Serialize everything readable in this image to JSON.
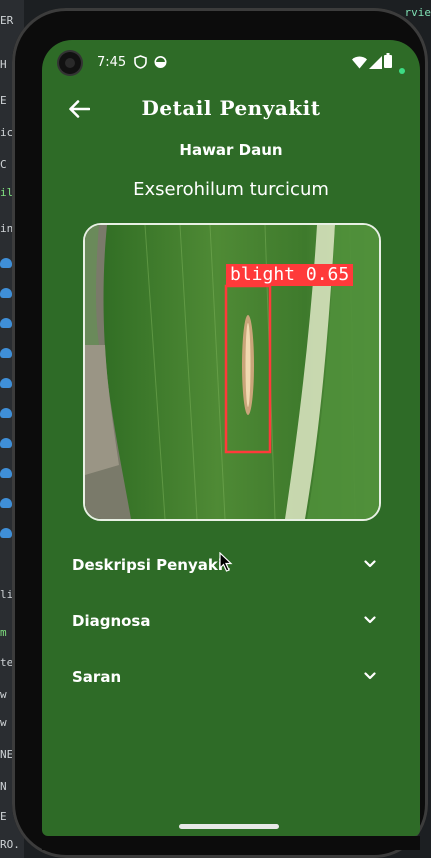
{
  "background_editor": {
    "right_text": "rvie",
    "left_fragments": [
      {
        "text": "ER",
        "color": "#cfd3d6"
      },
      {
        "text": "H",
        "color": "#cfd3d6"
      },
      {
        "text": "E",
        "color": "#cfd3d6"
      },
      {
        "text": "ic",
        "color": "#cfd3d6"
      },
      {
        "text": "C",
        "color": "#cfd3d6"
      },
      {
        "text": "ili",
        "color": "#7fe07f"
      },
      {
        "text": "in",
        "color": "#cfd3d6"
      },
      {
        "text": "lir",
        "color": "#cfd3d6"
      },
      {
        "text": "m",
        "color": "#7fe07f"
      },
      {
        "text": "te",
        "color": "#cfd3d6"
      },
      {
        "text": "w",
        "color": "#cfd3d6"
      },
      {
        "text": "w",
        "color": "#cfd3d6"
      },
      {
        "text": "NE",
        "color": "#cfd3d6"
      },
      {
        "text": "N",
        "color": "#cfd3d6"
      },
      {
        "text": "E",
        "color": "#cfd3d6"
      },
      {
        "text": "RO.",
        "color": "#cfd3d6"
      }
    ]
  },
  "status_bar": {
    "time": "7:45",
    "left_icons": [
      "shield-icon",
      "circle-half-icon"
    ],
    "right_icons": [
      "wifi-icon",
      "signal-icon",
      "battery-icon"
    ],
    "indicator_color": "#3ddc84"
  },
  "app_bar": {
    "title": "Detail Penyakit",
    "back_icon": "arrow-back-icon"
  },
  "disease": {
    "name": "Hawar Daun",
    "latin": "Exserohilum turcicum"
  },
  "detection": {
    "label": "blight 0.65",
    "box_color": "#ff3a3a"
  },
  "sections": [
    {
      "label": "Deskripsi Penyakit",
      "expanded": false
    },
    {
      "label": "Diagnosa",
      "expanded": false
    },
    {
      "label": "Saran",
      "expanded": false
    }
  ],
  "colors": {
    "app_background": "#2e6b27",
    "text": "#ffffff"
  }
}
